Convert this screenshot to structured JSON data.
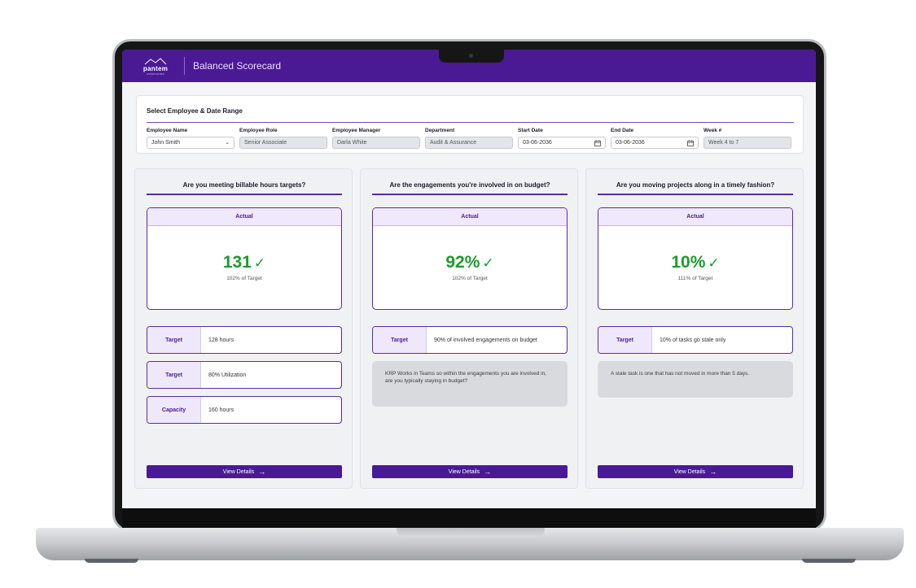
{
  "app": {
    "logo_text": "pantem",
    "logo_subtext": "ASSOCIATES",
    "title": "Balanced Scorecard"
  },
  "filters": {
    "heading": "Select Employee & Date Range",
    "fields": [
      {
        "label": "Employee Name",
        "value": "John Smith",
        "readonly": false,
        "icon": "chevron-down-icon"
      },
      {
        "label": "Employee Role",
        "value": "Senior Associate",
        "readonly": true
      },
      {
        "label": "Employee Manager",
        "value": "Darla White",
        "readonly": true
      },
      {
        "label": "Department",
        "value": "Audit & Assurance",
        "readonly": true
      },
      {
        "label": "Start Date",
        "value": "03-06-2036",
        "readonly": false,
        "icon": "calendar-icon"
      },
      {
        "label": "End Date",
        "value": "03-06-2036",
        "readonly": false,
        "icon": "calendar-icon"
      },
      {
        "label": "Week #",
        "value": "Week 4 to 7",
        "readonly": true
      }
    ]
  },
  "cards": [
    {
      "question": "Are you meeting billable hours targets?",
      "actual_label": "Actual",
      "actual_value": "131",
      "actual_sub": "102% of Target",
      "rows": [
        {
          "label": "Target",
          "value": "128 hours"
        },
        {
          "label": "Target",
          "value": "80% Utilization"
        },
        {
          "label": "Capacity",
          "value": "160 hours"
        }
      ],
      "button": "View Details"
    },
    {
      "question": "Are the engagements you're involved in on budget?",
      "actual_label": "Actual",
      "actual_value": "92%",
      "actual_sub": "102% of Target",
      "rows": [
        {
          "label": "Target",
          "value": "90% of involved engagements on budget"
        }
      ],
      "note": "KRP Works in Teams so within the engagements you are involved in, are you typically staying in budget?",
      "button": "View Details"
    },
    {
      "question": "Are you moving projects along in a timely fashion?",
      "actual_label": "Actual",
      "actual_value": "10%",
      "actual_sub": "111% of Target",
      "rows": [
        {
          "label": "Target",
          "value": "10% of tasks go stale only"
        }
      ],
      "note": "A stale task is one that has not moved in more than 5 days.",
      "button": "View Details"
    }
  ],
  "colors": {
    "brand": "#4a1a95",
    "success": "#1d9a2b"
  }
}
